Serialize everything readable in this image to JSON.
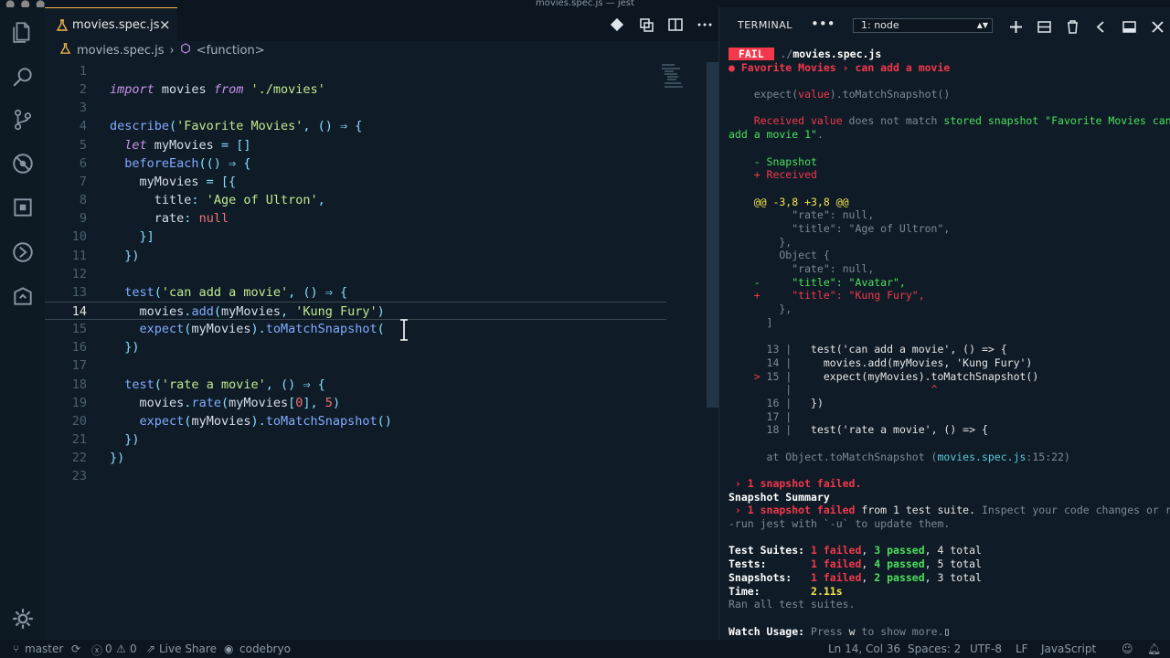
{
  "window": {
    "title": "movies.spec.js — jest"
  },
  "editor": {
    "tab": {
      "label": "movies.spec.js",
      "close": "×"
    },
    "breadcrumb": {
      "file": "movies.spec.js",
      "separator": "›",
      "symbol": "<function>"
    },
    "lines": [
      {
        "n": "1",
        "t": []
      },
      {
        "n": "2",
        "t": [
          [
            "kw",
            "import"
          ],
          [
            "var",
            " movies "
          ],
          [
            "kw",
            "from"
          ],
          [
            "str",
            " './movies'"
          ]
        ]
      },
      {
        "n": "3",
        "t": []
      },
      {
        "n": "4",
        "t": [
          [
            "fn",
            "describe"
          ],
          [
            "pun",
            "("
          ],
          [
            "str",
            "'Favorite Movies'"
          ],
          [
            "pun",
            ", "
          ],
          [
            "pun",
            "() ⇒ {"
          ]
        ]
      },
      {
        "n": "5",
        "t": [
          [
            "ws",
            "  "
          ],
          [
            "kw",
            "let"
          ],
          [
            "var",
            " myMovies "
          ],
          [
            "pun",
            "= []"
          ]
        ]
      },
      {
        "n": "6",
        "t": [
          [
            "ws",
            "  "
          ],
          [
            "fn",
            "beforeEach"
          ],
          [
            "pun",
            "(() ⇒ {"
          ]
        ]
      },
      {
        "n": "7",
        "t": [
          [
            "ws",
            "    "
          ],
          [
            "var",
            "myMovies "
          ],
          [
            "pun",
            "= [{"
          ]
        ]
      },
      {
        "n": "8",
        "t": [
          [
            "ws",
            "      "
          ],
          [
            "prop",
            "title"
          ],
          [
            "pun",
            ": "
          ],
          [
            "str",
            "'Age of Ultron'"
          ],
          [
            "pun",
            ","
          ]
        ]
      },
      {
        "n": "9",
        "t": [
          [
            "ws",
            "      "
          ],
          [
            "prop",
            "rate"
          ],
          [
            "pun",
            ": "
          ],
          [
            "nul",
            "null"
          ]
        ]
      },
      {
        "n": "10",
        "t": [
          [
            "ws",
            "    "
          ],
          [
            "pun",
            "}]"
          ]
        ]
      },
      {
        "n": "11",
        "t": [
          [
            "ws",
            "  "
          ],
          [
            "pun",
            "})"
          ]
        ]
      },
      {
        "n": "12",
        "t": []
      },
      {
        "n": "13",
        "t": [
          [
            "ws",
            "  "
          ],
          [
            "fn",
            "test"
          ],
          [
            "pun",
            "("
          ],
          [
            "str",
            "'can add a movie'"
          ],
          [
            "pun",
            ", () ⇒ {"
          ]
        ]
      },
      {
        "n": "14",
        "t": [
          [
            "ws",
            "    "
          ],
          [
            "var",
            "movies"
          ],
          [
            "pun",
            "."
          ],
          [
            "fn",
            "add"
          ],
          [
            "pun",
            "("
          ],
          [
            "var",
            "myMovies"
          ],
          [
            "pun",
            ", "
          ],
          [
            "str",
            "'Kung Fury'"
          ],
          [
            "pun",
            ")"
          ]
        ]
      },
      {
        "n": "15",
        "t": [
          [
            "ws",
            "    "
          ],
          [
            "fn",
            "expect"
          ],
          [
            "pun",
            "("
          ],
          [
            "var",
            "myMovies"
          ],
          [
            "pun",
            ")."
          ],
          [
            "fn",
            "toMatchSnapshot"
          ],
          [
            "pun",
            "("
          ]
        ]
      },
      {
        "n": "16",
        "t": [
          [
            "ws",
            "  "
          ],
          [
            "pun",
            "})"
          ]
        ]
      },
      {
        "n": "17",
        "t": []
      },
      {
        "n": "18",
        "t": [
          [
            "ws",
            "  "
          ],
          [
            "fn",
            "test"
          ],
          [
            "pun",
            "("
          ],
          [
            "str",
            "'rate a movie'"
          ],
          [
            "pun",
            ", () ⇒ {"
          ]
        ]
      },
      {
        "n": "19",
        "t": [
          [
            "ws",
            "    "
          ],
          [
            "var",
            "movies"
          ],
          [
            "pun",
            "."
          ],
          [
            "fn",
            "rate"
          ],
          [
            "pun",
            "("
          ],
          [
            "var",
            "myMovies"
          ],
          [
            "pun",
            "["
          ],
          [
            "nul",
            "0"
          ],
          [
            "pun",
            "], "
          ],
          [
            "nul",
            "5"
          ],
          [
            "pun",
            ")"
          ]
        ]
      },
      {
        "n": "20",
        "t": [
          [
            "ws",
            "    "
          ],
          [
            "fn",
            "expect"
          ],
          [
            "pun",
            "("
          ],
          [
            "var",
            "myMovies"
          ],
          [
            "pun",
            ")."
          ],
          [
            "fn",
            "toMatchSnapshot"
          ],
          [
            "pun",
            "()"
          ]
        ]
      },
      {
        "n": "21",
        "t": [
          [
            "ws",
            "  "
          ],
          [
            "pun",
            "})"
          ]
        ]
      },
      {
        "n": "22",
        "t": [
          [
            "pun",
            "})"
          ]
        ]
      },
      {
        "n": "23",
        "t": []
      }
    ],
    "active_line": "14"
  },
  "terminal": {
    "title": "TERMINAL",
    "more": "•••",
    "select_value": "1: node",
    "lines": [
      [
        [
          "fail-badge",
          " FAIL "
        ],
        [
          "dim",
          " ./"
        ],
        [
          "whiteb",
          "movies.spec.js"
        ]
      ],
      [
        [
          "redb",
          "● Favorite Movies › can add a movie"
        ]
      ],
      [],
      [
        [
          "dim",
          "    expect("
        ],
        [
          "red",
          "value"
        ],
        [
          "dim",
          ").toMatchSnapshot()"
        ]
      ],
      [],
      [
        [
          "red",
          "    Received value"
        ],
        [
          "dim",
          " does not match "
        ],
        [
          "green",
          "stored snapshot \"Favorite Movies can"
        ]
      ],
      [
        [
          "green",
          "add a movie 1\""
        ],
        [
          "dim",
          "."
        ]
      ],
      [],
      [
        [
          "green",
          "    - Snapshot"
        ]
      ],
      [
        [
          "red",
          "    + Received"
        ]
      ],
      [],
      [
        [
          "yellow",
          "    @@ -3,8 +3,8 @@"
        ]
      ],
      [
        [
          "dim",
          "          \"rate\": null,"
        ]
      ],
      [
        [
          "dim",
          "          \"title\": \"Age of Ultron\","
        ]
      ],
      [
        [
          "dim",
          "        },"
        ]
      ],
      [
        [
          "dim",
          "        Object {"
        ]
      ],
      [
        [
          "dim",
          "          \"rate\": null,"
        ]
      ],
      [
        [
          "green",
          "    -     \"title\": \"Avatar\","
        ]
      ],
      [
        [
          "red",
          "    +     \"title\": \"Kung Fury\","
        ]
      ],
      [
        [
          "dim",
          "        },"
        ]
      ],
      [
        [
          "dim",
          "      ]"
        ]
      ],
      [],
      [
        [
          "dim",
          "      13 |   "
        ],
        [
          "white",
          "test('can add a movie', () => {"
        ]
      ],
      [
        [
          "dim",
          "      14 |     "
        ],
        [
          "white",
          "movies.add(myMovies, 'Kung Fury')"
        ]
      ],
      [
        [
          "red",
          "    > "
        ],
        [
          "dim",
          "15 |     "
        ],
        [
          "white",
          "expect(myMovies).toMatchSnapshot()"
        ]
      ],
      [
        [
          "dim",
          "         |                      "
        ],
        [
          "red",
          "^"
        ]
      ],
      [
        [
          "dim",
          "      16 |   "
        ],
        [
          "white",
          "})"
        ]
      ],
      [
        [
          "dim",
          "      17 |"
        ]
      ],
      [
        [
          "dim",
          "      18 |   "
        ],
        [
          "white",
          "test('rate a movie', () => {"
        ]
      ],
      [],
      [
        [
          "dim",
          "      at Object.toMatchSnapshot ("
        ],
        [
          "cyan",
          "movies.spec.js"
        ],
        [
          "dim",
          ":15:22)"
        ]
      ],
      [],
      [
        [
          "redb",
          " › 1 snapshot failed."
        ]
      ],
      [
        [
          "whiteb",
          "Snapshot Summary"
        ]
      ],
      [
        [
          "redb",
          " › 1 snapshot failed"
        ],
        [
          "white",
          " from 1 test suite. "
        ],
        [
          "dim",
          "Inspect your code changes or re"
        ]
      ],
      [
        [
          "dim",
          "-run jest with `-u` to update them."
        ]
      ],
      [],
      [
        [
          "whiteb",
          "Test Suites: "
        ],
        [
          "redb",
          "1 failed"
        ],
        [
          "white",
          ", "
        ],
        [
          "greenb",
          "3 passed"
        ],
        [
          "white",
          ", 4 total"
        ]
      ],
      [
        [
          "whiteb",
          "Tests:       "
        ],
        [
          "redb",
          "1 failed"
        ],
        [
          "white",
          ", "
        ],
        [
          "greenb",
          "4 passed"
        ],
        [
          "white",
          ", 5 total"
        ]
      ],
      [
        [
          "whiteb",
          "Snapshots:   "
        ],
        [
          "redb",
          "1 failed"
        ],
        [
          "white",
          ", "
        ],
        [
          "greenb",
          "2 passed"
        ],
        [
          "white",
          ", 3 total"
        ]
      ],
      [
        [
          "whiteb",
          "Time:        "
        ],
        [
          "yellowb",
          "2.11s"
        ]
      ],
      [
        [
          "dim",
          "Ran all test suites."
        ]
      ],
      [],
      [
        [
          "whiteb",
          "Watch Usage: "
        ],
        [
          "dim",
          "Press "
        ],
        [
          "white",
          "w"
        ],
        [
          "dim",
          " to show more."
        ],
        [
          "white",
          "▯"
        ]
      ]
    ]
  },
  "status": {
    "branch": "master",
    "errors": "0",
    "warnings": "0",
    "live_share": "Live Share",
    "account": "codebryo",
    "position": "Ln 14, Col 36",
    "spaces": "Spaces: 2",
    "encoding": "UTF-8",
    "eol": "LF",
    "language": "JavaScript"
  },
  "colors": {
    "accent": "#f3b64a",
    "fail": "#f5374b",
    "pass": "#4be05a",
    "background": "#0f1c27"
  }
}
